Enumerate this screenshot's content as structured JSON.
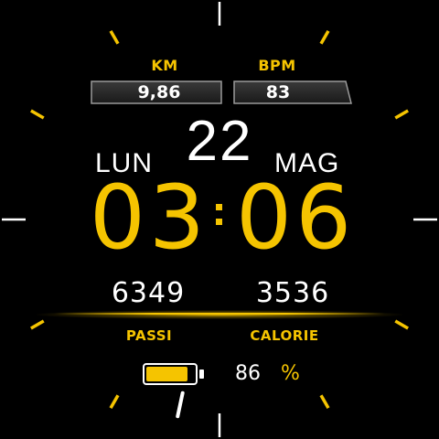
{
  "watchface": {
    "distance": {
      "label": "KM",
      "value": "9,86"
    },
    "heart_rate": {
      "label": "BPM",
      "value": "83"
    },
    "date": {
      "weekday": "LUN",
      "day": "22",
      "month": "MAG"
    },
    "time": {
      "hours": "03",
      "minutes": "06"
    },
    "steps": {
      "label": "PASSI",
      "value": "6349"
    },
    "calories": {
      "label": "CALORIE",
      "value": "3536"
    },
    "battery": {
      "percent": "86",
      "unit": "%",
      "level": 0.86
    },
    "seconds_hand": {
      "second": 32
    }
  },
  "colors": {
    "accent": "#f5c400",
    "text": "#ffffff",
    "background": "#000000",
    "bezel_gray": "#9a9a9a"
  },
  "icons": {
    "battery": "battery-icon"
  }
}
